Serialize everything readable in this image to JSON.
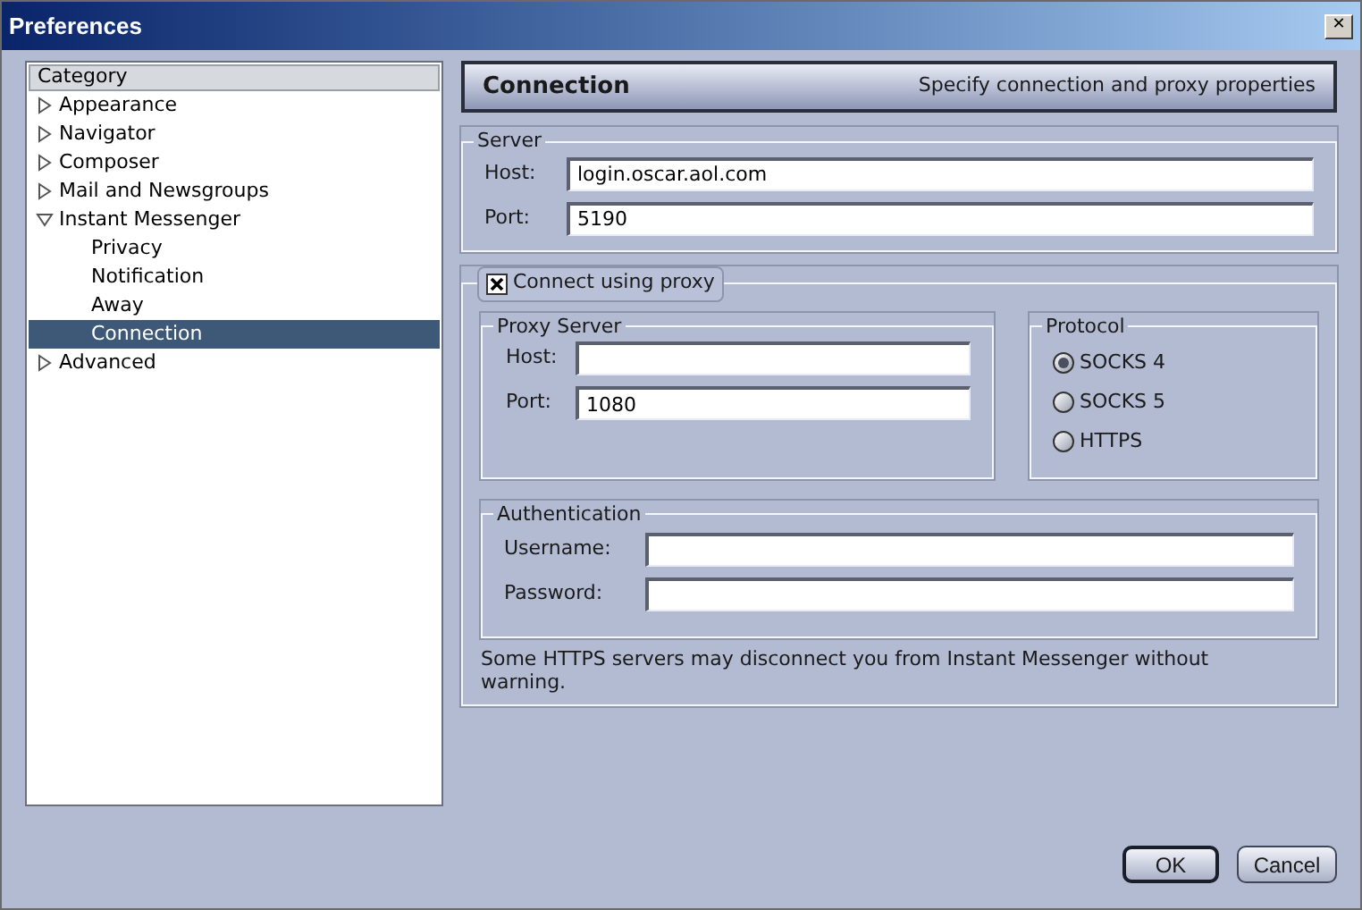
{
  "window": {
    "title": "Preferences",
    "close": "✕"
  },
  "sidebar": {
    "header": "Category",
    "items": [
      {
        "label": "Appearance",
        "expanded": false,
        "selected": false
      },
      {
        "label": "Navigator",
        "expanded": false,
        "selected": false
      },
      {
        "label": "Composer",
        "expanded": false,
        "selected": false
      },
      {
        "label": "Mail and Newsgroups",
        "expanded": false,
        "selected": false
      },
      {
        "label": "Instant Messenger",
        "expanded": true,
        "selected": false,
        "children": [
          {
            "label": "Privacy",
            "selected": false
          },
          {
            "label": "Notification",
            "selected": false
          },
          {
            "label": "Away",
            "selected": false
          },
          {
            "label": "Connection",
            "selected": true
          }
        ]
      },
      {
        "label": "Advanced",
        "expanded": false,
        "selected": false
      }
    ]
  },
  "header": {
    "title": "Connection",
    "subtitle": "Specify connection and proxy properties"
  },
  "server": {
    "legend": "Server",
    "fields": [
      {
        "label": "Host:",
        "value": "login.oscar.aol.com"
      },
      {
        "label": "Port:",
        "value": "5190"
      }
    ]
  },
  "proxy": {
    "checkbox": {
      "label": "Connect using proxy",
      "checked": true
    },
    "proxy_server": {
      "legend": "Proxy Server",
      "fields": [
        {
          "label": "Host:"
        },
        {
          "label": "Port:",
          "value": "1080"
        }
      ]
    },
    "protocol": {
      "legend": "Protocol",
      "options": [
        {
          "label": "SOCKS 4",
          "selected": true
        },
        {
          "label": "SOCKS 5",
          "selected": false
        },
        {
          "label": "HTTPS",
          "selected": false
        }
      ]
    },
    "authentication": {
      "legend": "Authentication",
      "fields": [
        {
          "label": "Username:"
        },
        {
          "label": "Password:"
        }
      ]
    },
    "note": "Some HTTPS servers may disconnect you from Instant Messenger without warning."
  },
  "buttons": [
    {
      "label": "OK",
      "default": true
    },
    {
      "label": "Cancel",
      "default": false
    }
  ]
}
